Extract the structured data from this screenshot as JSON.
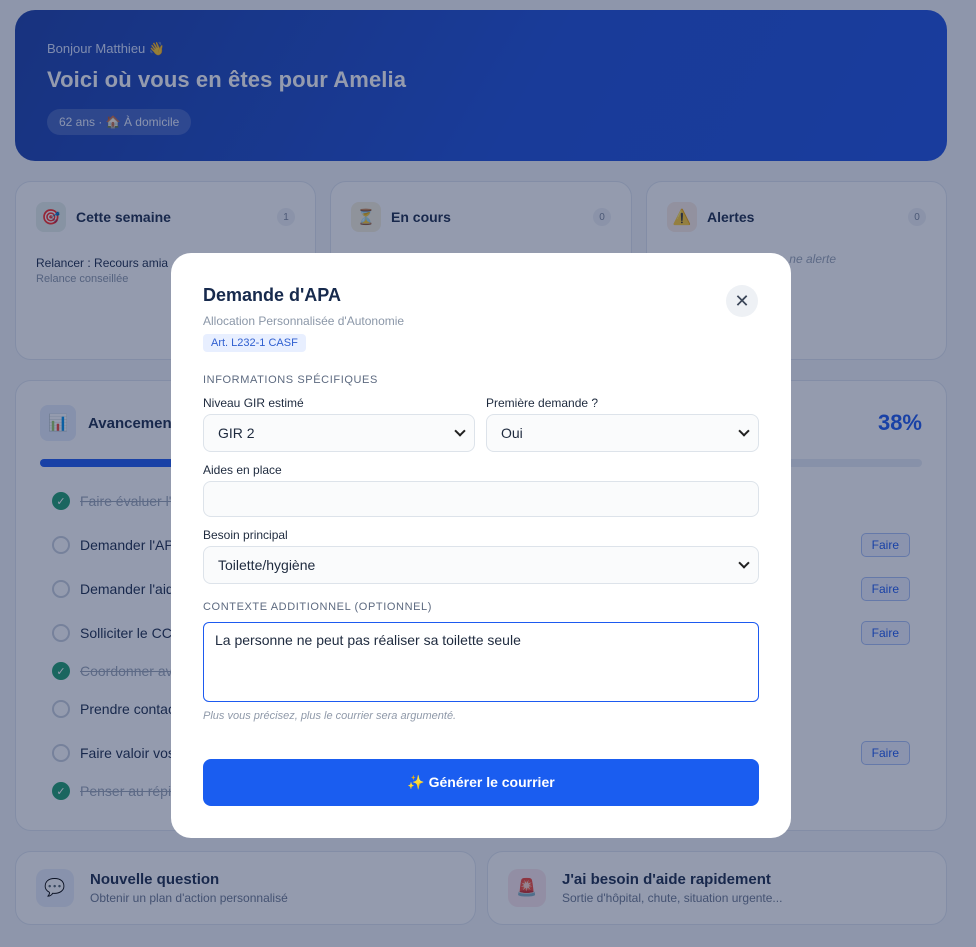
{
  "hero": {
    "greeting": "Bonjour Matthieu 👋",
    "title": "Voici où vous en êtes pour Amelia",
    "pill": "62 ans · 🏠 À domicile"
  },
  "stats": [
    {
      "icon": "🎯",
      "title": "Cette semaine",
      "count": "1",
      "item": "Relancer : Recours amia",
      "item_sub": "Relance conseillée"
    },
    {
      "icon": "⏳",
      "title": "En cours",
      "count": "0"
    },
    {
      "icon": "⚠️",
      "title": "Alertes",
      "count": "0",
      "empty": "ne alerte"
    }
  ],
  "progress": {
    "icon": "📊",
    "title": "Avancemen",
    "percent_label": "38%",
    "percent": 38,
    "action_label": "Faire",
    "tasks": [
      {
        "label": "Faire évaluer l'",
        "done": true,
        "action": false
      },
      {
        "label": "Demander l'AP",
        "done": false,
        "action": true
      },
      {
        "label": "Demander l'aid",
        "done": false,
        "action": true
      },
      {
        "label": "Solliciter le CC",
        "done": false,
        "action": true
      },
      {
        "label": "Coordonner av",
        "done": true,
        "action": false
      },
      {
        "label": "Prendre contac",
        "done": false,
        "action": false
      },
      {
        "label": "Faire valoir vos",
        "done": false,
        "action": true
      },
      {
        "label": "Penser au répit",
        "done": true,
        "action": false
      }
    ]
  },
  "bottom": [
    {
      "icon": "💬",
      "title": "Nouvelle question",
      "sub": "Obtenir un plan d'action personnalisé"
    },
    {
      "icon": "🚨",
      "title": "J'ai besoin d'aide rapidement",
      "sub": "Sortie d'hôpital, chute, situation urgente..."
    }
  ],
  "modal": {
    "title": "Demande d'APA",
    "subtitle": "Allocation Personnalisée d'Autonomie",
    "tag": "Art. L232-1 CASF",
    "section_specific": "Informations spécifiques",
    "gir_label": "Niveau GIR estimé",
    "gir_value": "GIR 2",
    "first_label": "Première demande ?",
    "first_value": "Oui",
    "aides_label": "Aides en place",
    "aides_value": "",
    "besoin_label": "Besoin principal",
    "besoin_value": "Toilette/hygiène",
    "section_context": "Contexte additionnel (optionnel)",
    "context_value": "La personne ne peut pas réaliser sa toilette seule",
    "hint": "Plus vous précisez, plus le courrier sera argumenté.",
    "button": "✨ Générer le courrier"
  }
}
